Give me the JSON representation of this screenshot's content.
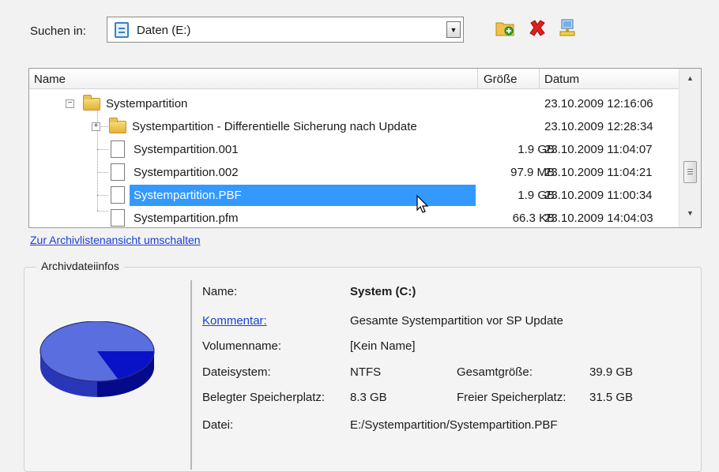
{
  "search": {
    "label": "Suchen in:",
    "location": "Daten (E:)",
    "dropdown_icon": "▼",
    "icons": [
      "new-folder-icon",
      "delete-icon",
      "network-icon"
    ]
  },
  "table": {
    "columns": [
      "Name",
      "Größe",
      "Datum"
    ],
    "rows": [
      {
        "name": "Systempartition",
        "size": "",
        "date": "23.10.2009 12:16:06",
        "type": "folder"
      },
      {
        "name": "Systempartition - Differentielle Sicherung nach Update",
        "size": "",
        "date": "23.10.2009 12:28:34",
        "type": "folder"
      },
      {
        "name": "Systempartition.001",
        "size": "1.9 GB",
        "date": "23.10.2009 11:04:07",
        "type": "file"
      },
      {
        "name": "Systempartition.002",
        "size": "97.9 MB",
        "date": "23.10.2009 11:04:21",
        "type": "file"
      },
      {
        "name": "Systempartition.PBF",
        "size": "1.9 GB",
        "date": "23.10.2009 11:00:34",
        "type": "file",
        "selected": true
      },
      {
        "name": "Systempartition.pfm",
        "size": "66.3 KB",
        "date": "23.10.2009 14:04:03",
        "type": "file"
      }
    ]
  },
  "toggle_link": "Zur Archivlistenansicht umschalten",
  "info": {
    "group_title": "Archivdateiinfos",
    "name_label": "Name:",
    "name_value": "System (C:)",
    "comment_label": "Kommentar:",
    "comment_value": "Gesamte Systempartition vor SP Update",
    "volume_label": "Volumenname:",
    "volume_value": "[Kein Name]",
    "fs_label": "Dateisystem:",
    "fs_value": "NTFS",
    "total_label": "Gesamtgröße:",
    "total_value": "39.9 GB",
    "used_label": "Belegter Speicherplatz:",
    "used_value": "8.3 GB",
    "free_label": "Freier Speicherplatz:",
    "free_value": "31.5 GB",
    "file_label": "Datei:",
    "file_value": "E:/Systempartition/Systempartition.PBF"
  },
  "colors": {
    "selection": "#3399ff",
    "link": "#1a3fd6",
    "pie_free": "#5a6ee0",
    "pie_used": "#0a12c8"
  }
}
